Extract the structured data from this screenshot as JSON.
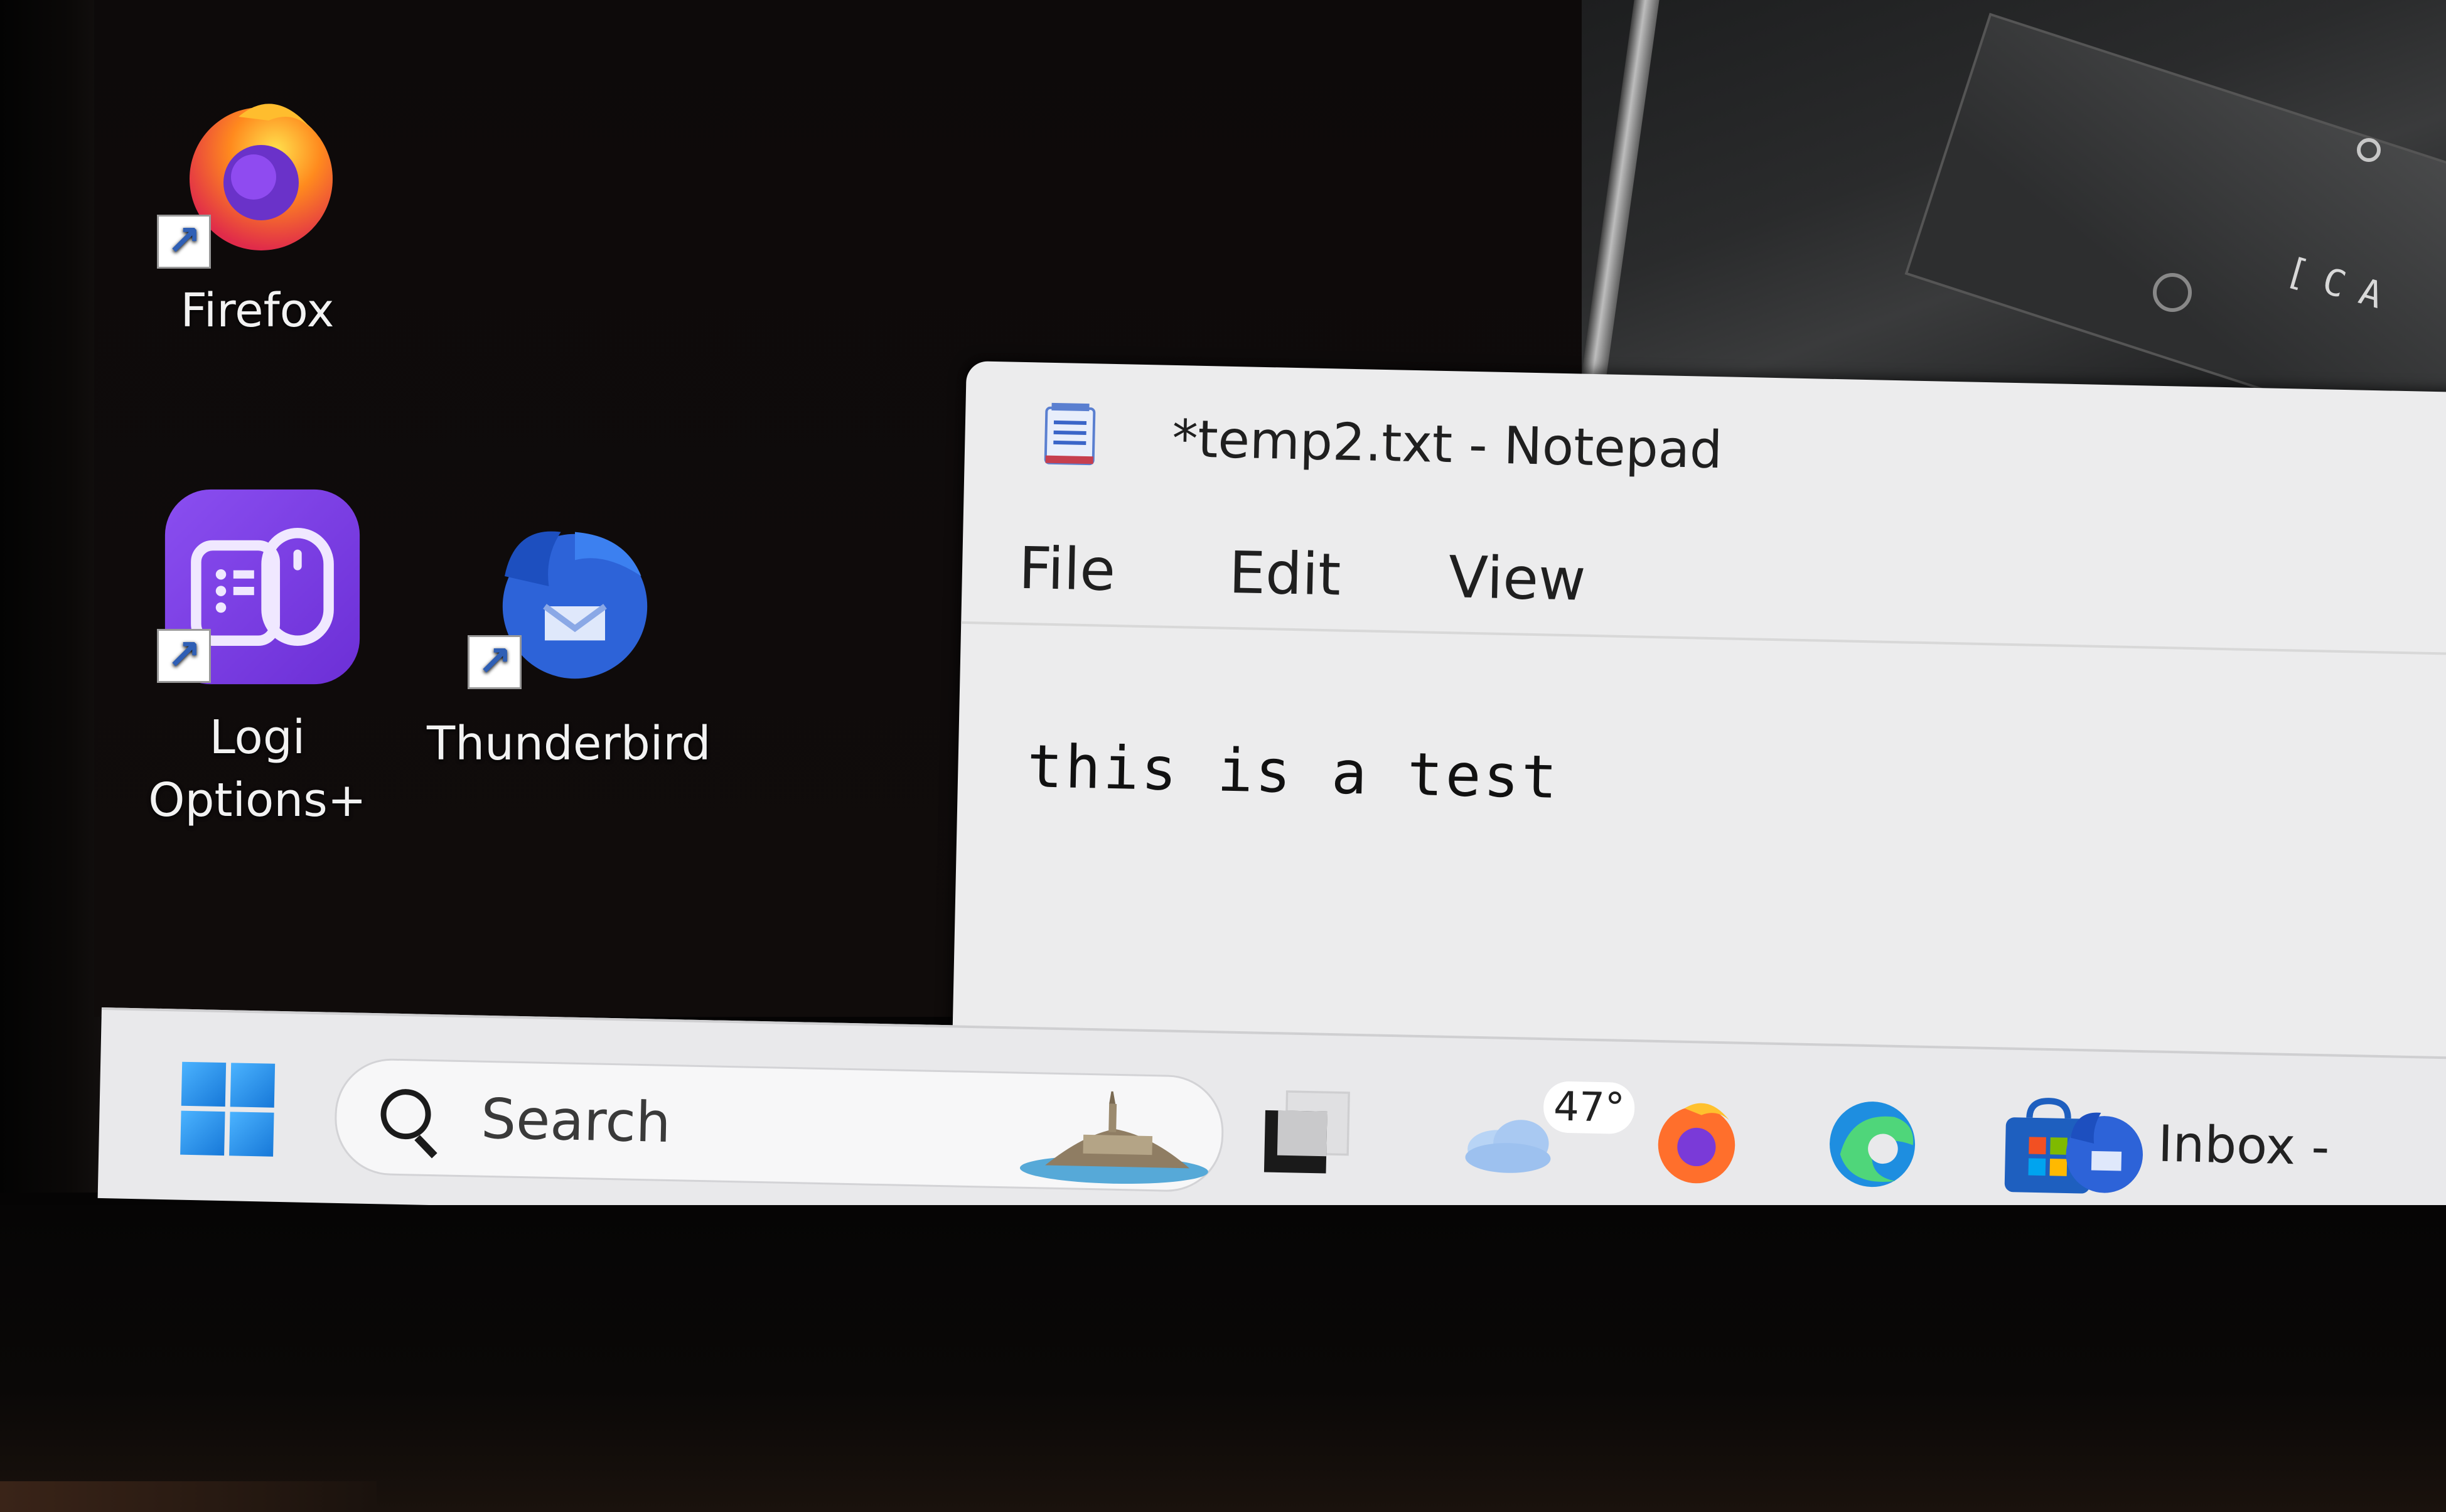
{
  "desktop": {
    "icons": [
      {
        "label": "Firefox"
      },
      {
        "label_line1": "Logi",
        "label_line2": "Options+"
      },
      {
        "label": "Thunderbird"
      }
    ],
    "wallpaper_text": "[CA"
  },
  "notepad": {
    "title": "*temp2.txt - Notepad",
    "menus": [
      "File",
      "Edit",
      "View"
    ],
    "content": "this is a test"
  },
  "taskbar": {
    "search_placeholder": "Search",
    "weather_temp": "47°",
    "apps": [
      "task-view",
      "weather",
      "firefox",
      "edge",
      "microsoft-store",
      "thunderbird"
    ],
    "thunderbird_label": "Inbox -"
  },
  "colors": {
    "taskbar_bg": "#e9e9eb",
    "notepad_bg": "#ececed",
    "desktop_bg": "#0f0b0b",
    "windows_accent": "#1778d8"
  }
}
